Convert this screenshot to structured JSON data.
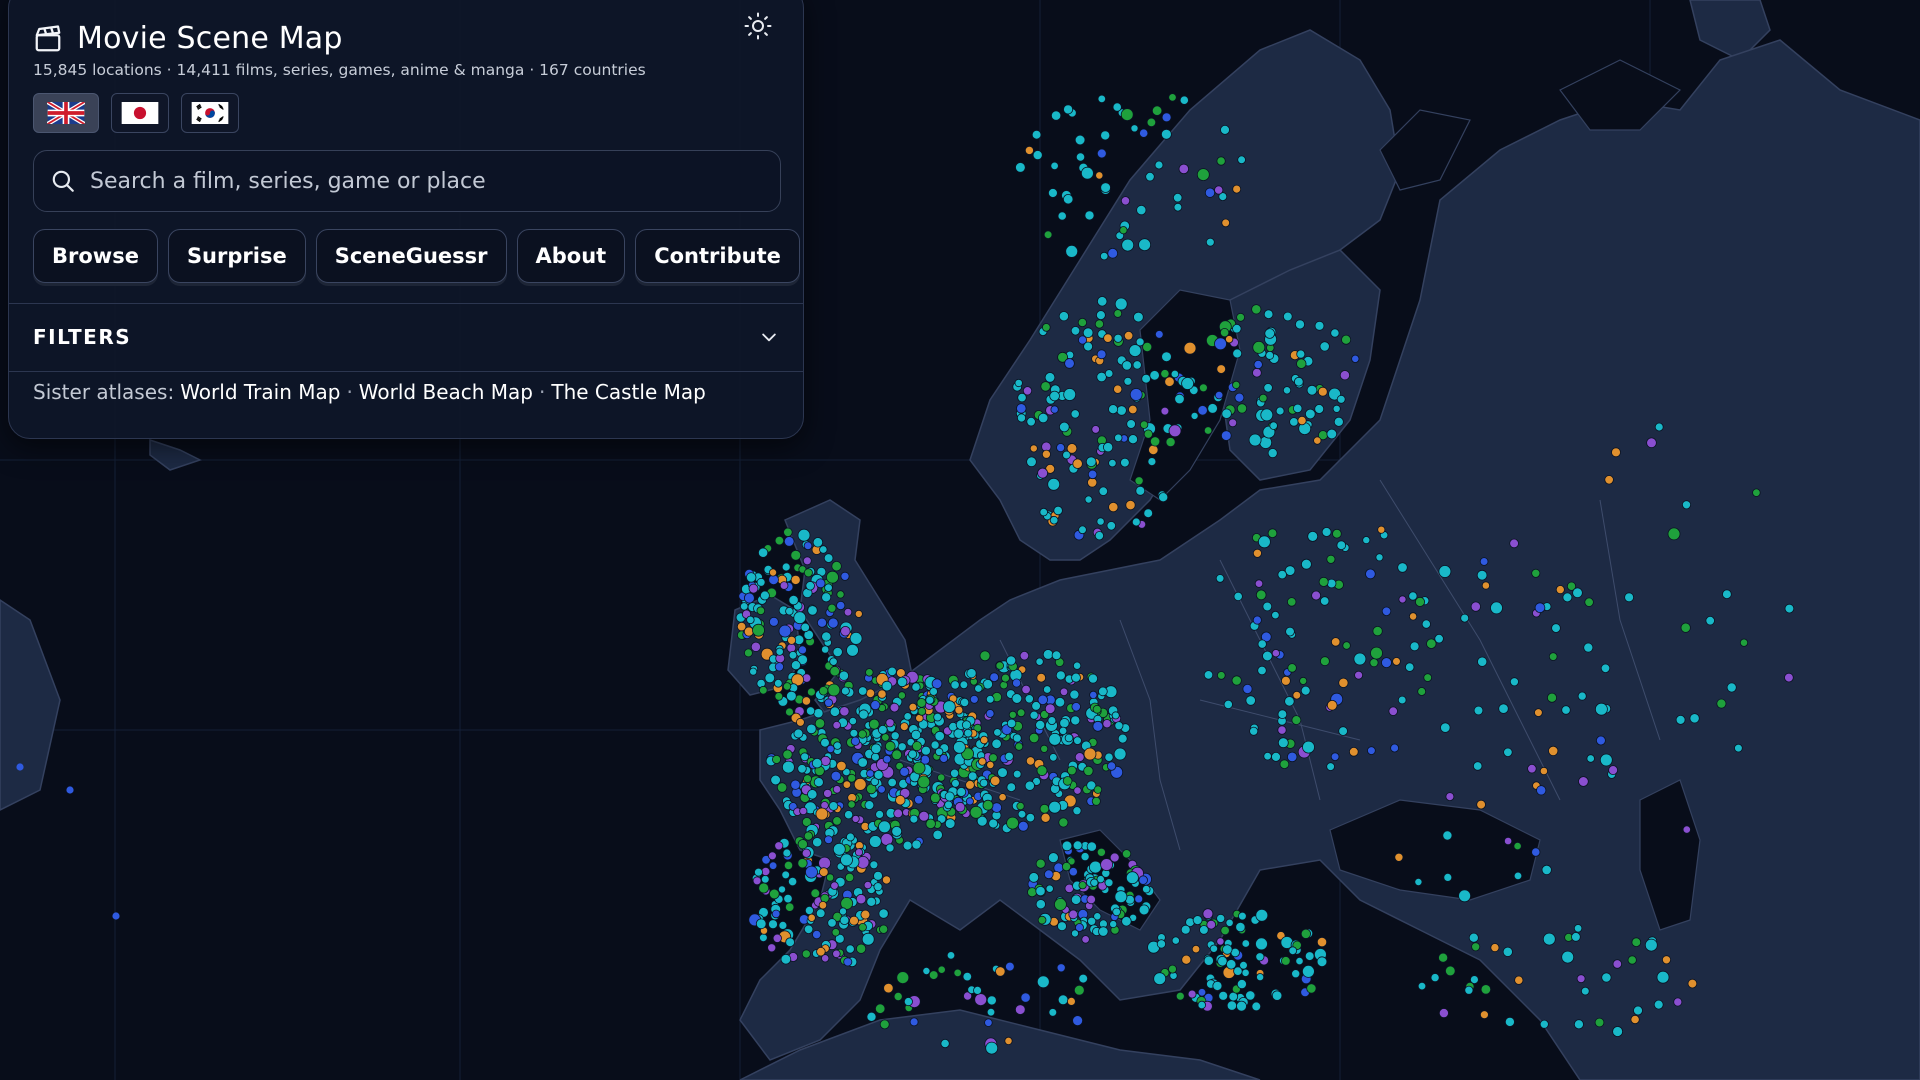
{
  "header": {
    "title": "Movie Scene Map",
    "stats": "15,845 locations · 14,411 films, series, games, anime & manga · 167 countries",
    "icons": {
      "logo": "clapperboard-icon",
      "theme": "sun-icon"
    }
  },
  "languages": [
    {
      "code": "en",
      "flag": "uk-flag",
      "active": true
    },
    {
      "code": "ja",
      "flag": "japan-flag",
      "active": false
    },
    {
      "code": "ko",
      "flag": "korea-flag",
      "active": false
    }
  ],
  "search": {
    "placeholder": "Search a film, series, game or place",
    "value": ""
  },
  "nav": {
    "browse": "Browse",
    "surprise": "Surprise",
    "sceneguessr": "SceneGuessr",
    "about": "About",
    "contribute": "Contribute"
  },
  "filters": {
    "label": "FILTERS",
    "expanded": false
  },
  "sister": {
    "prefix": "Sister atlases:",
    "sep": "·",
    "links": [
      "World Train Map",
      "World Beach Map",
      "The Castle Map"
    ]
  },
  "map": {
    "region": "Europe",
    "colors": {
      "ocean": "#080d1a",
      "land": "#1d2a44",
      "borders": "#3e4c6c",
      "marker_cyan": "#19b8c8",
      "marker_green": "#1fa13c",
      "marker_purple": "#8a4fd0",
      "marker_blue": "#2f5ae0",
      "marker_orange": "#e0902e"
    }
  }
}
